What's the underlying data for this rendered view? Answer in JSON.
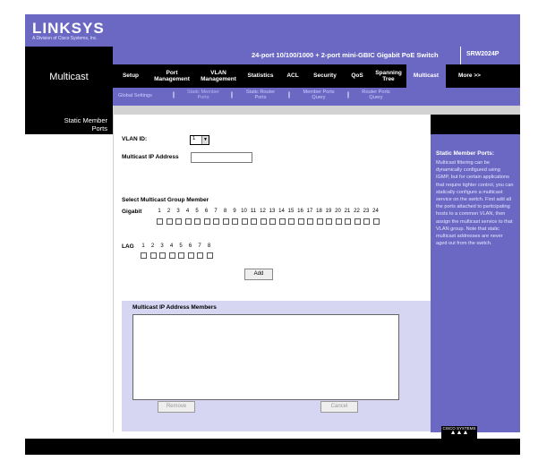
{
  "brand": {
    "logo": "LINKSYS",
    "subtitle": "A Division of Cisco Systems, Inc."
  },
  "product": {
    "name": "24-port 10/100/1000 + 2-port mini-GBIC Gigabit PoE Switch",
    "model": "SRW2024P"
  },
  "section_title": "Multicast",
  "tabs": [
    {
      "label": "Setup"
    },
    {
      "label": "Port\nManagement"
    },
    {
      "label": "VLAN\nManagement"
    },
    {
      "label": "Statistics"
    },
    {
      "label": "ACL"
    },
    {
      "label": "Security"
    },
    {
      "label": "QoS"
    },
    {
      "label": "Spanning\nTree"
    },
    {
      "label": "Multicast"
    },
    {
      "label": "More >>"
    }
  ],
  "subtabs": [
    {
      "label": "Global Settings"
    },
    {
      "label": "Static Member\nPorts"
    },
    {
      "label": "Static Router\nPorts"
    },
    {
      "label": "Member Ports\nQuery"
    },
    {
      "label": "Router Ports\nQuery"
    }
  ],
  "left_panel": {
    "title": "Static Member\nPorts"
  },
  "form": {
    "vlan_id_label": "VLAN ID:",
    "vlan_id_value": "1",
    "multicast_ip_label": "Multicast IP Address",
    "multicast_ip_value": "",
    "group_member_label": "Select Multicast Group Member",
    "gigabit_label": "Gigabit",
    "gigabit_ports": [
      "1",
      "2",
      "3",
      "4",
      "5",
      "6",
      "7",
      "8",
      "9",
      "10",
      "11",
      "12",
      "13",
      "14",
      "15",
      "16",
      "17",
      "18",
      "19",
      "20",
      "21",
      "22",
      "23",
      "24"
    ],
    "lag_label": "LAG",
    "lag_ports": [
      "1",
      "2",
      "3",
      "4",
      "5",
      "6",
      "7",
      "8"
    ],
    "add_button": "Add"
  },
  "members_table": {
    "header": "Multicast IP Address  Members",
    "remove_button": "Remove",
    "cancel_button": "Cancel"
  },
  "help": {
    "title": "Static Member Ports:",
    "text": "Multicast filtering can be dynamically configured using IGMP, but for certain applications that require tighter control, you can statically configure a multicast service on the switch. First add all the ports attached to participating hosts to a common VLAN, then assign the multicast service to that VLAN group. Note that static multicast addresses are never aged out from the switch."
  },
  "footer_logo": "CISCO SYSTEMS",
  "colors": {
    "accent": "#6b68c4",
    "dark": "#000000",
    "panel": "#d6d5f2"
  }
}
